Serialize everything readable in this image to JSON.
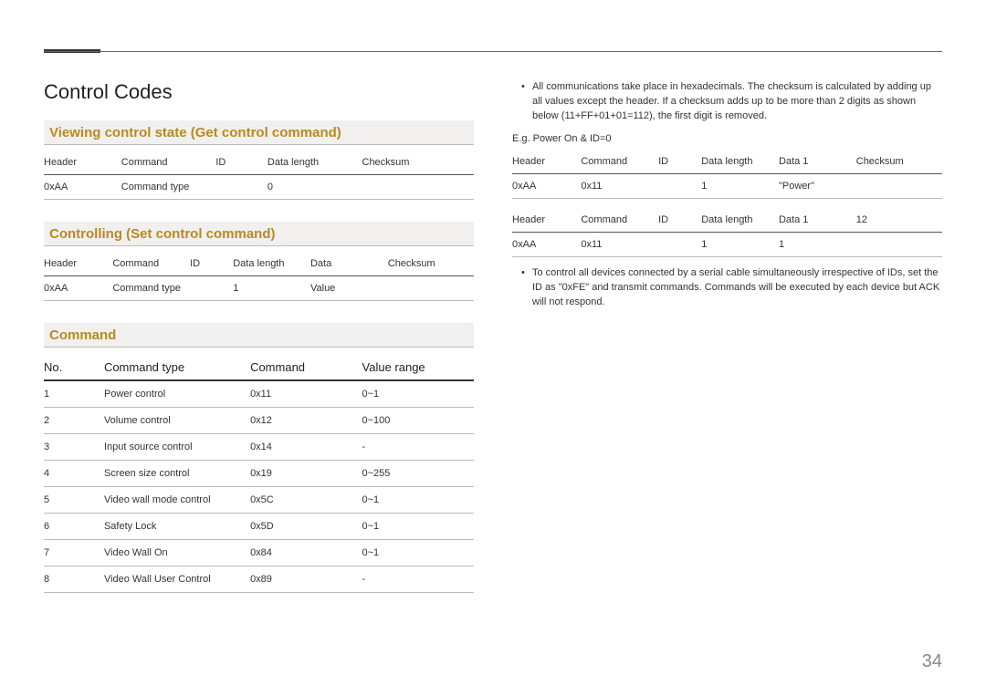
{
  "page_number": "34",
  "left": {
    "title": "Control Codes",
    "section1": {
      "heading": "Viewing control state (Get control command)",
      "headers": [
        "Header",
        "Command",
        "ID",
        "Data length",
        "Checksum"
      ],
      "row": [
        "0xAA",
        "Command type",
        "",
        "0",
        ""
      ]
    },
    "section2": {
      "heading": "Controlling (Set control command)",
      "headers": [
        "Header",
        "Command",
        "ID",
        "Data length",
        "Data",
        "Checksum"
      ],
      "row": [
        "0xAA",
        "Command type",
        "",
        "1",
        "Value",
        ""
      ]
    },
    "section3": {
      "heading": "Command",
      "headers": [
        "No.",
        "Command type",
        "Command",
        "Value range"
      ],
      "rows": [
        [
          "1",
          "Power control",
          "0x11",
          "0~1"
        ],
        [
          "2",
          "Volume control",
          "0x12",
          "0~100"
        ],
        [
          "3",
          "Input source control",
          "0x14",
          "-"
        ],
        [
          "4",
          "Screen size control",
          "0x19",
          "0~255"
        ],
        [
          "5",
          "Video wall mode control",
          "0x5C",
          "0~1"
        ],
        [
          "6",
          "Safety Lock",
          "0x5D",
          "0~1"
        ],
        [
          "7",
          "Video Wall On",
          "0x84",
          "0~1"
        ],
        [
          "8",
          "Video Wall User Control",
          "0x89",
          "-"
        ]
      ]
    }
  },
  "right": {
    "bullet1": "All communications take place in hexadecimals. The checksum is calculated by adding up all values except the header. If a checksum adds up to be more than 2 digits as shown below (11+FF+01+01=112), the first digit is removed.",
    "eg_label": "E.g. Power On & ID=0",
    "t1": {
      "headers": [
        "Header",
        "Command",
        "ID",
        "Data length",
        "Data 1",
        "Checksum"
      ],
      "row": [
        "0xAA",
        "0x11",
        "",
        "1",
        "\"Power\"",
        ""
      ]
    },
    "t2": {
      "headers": [
        "Header",
        "Command",
        "ID",
        "Data length",
        "Data 1",
        "12"
      ],
      "row": [
        "0xAA",
        "0x11",
        "",
        "1",
        "1",
        ""
      ]
    },
    "bullet2": "To control all devices connected by a serial cable simultaneously irrespective of IDs, set the ID as \"0xFE\" and transmit commands. Commands will be executed by each device but ACK will not respond."
  }
}
